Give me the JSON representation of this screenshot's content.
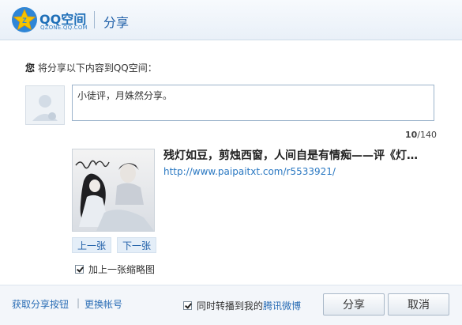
{
  "header": {
    "logo_text": "QQ空间",
    "logo_sub": "QZONE.QQ.COM",
    "title": "分享"
  },
  "prompt": {
    "bold": "您",
    "text": "将分享以下内容到QQ空间："
  },
  "comment": {
    "value": "小徒评，月姝然分享。"
  },
  "counter": {
    "current": "10",
    "total": "/140"
  },
  "article": {
    "title": "残灯如豆，剪烛西窗，人间自是有情痴——评《灯…",
    "url": "http://www.paipaitxt.com/r5533921/"
  },
  "thumbnail": {
    "prev_label": "上一张",
    "next_label": "下一张",
    "include_label": "加上一张缩略图",
    "include_checked": true
  },
  "footer": {
    "get_share_button": "获取分享按钮",
    "separator": "|",
    "switch_account": "更换帐号",
    "sync_prefix": "同时转播到我的",
    "sync_link": "腾讯微博",
    "sync_checked": true,
    "share_button": "分享",
    "cancel_button": "取消"
  },
  "colors": {
    "link": "#2a6db5",
    "header_title": "#1f5fa8",
    "logo_star": "#f5b800"
  }
}
